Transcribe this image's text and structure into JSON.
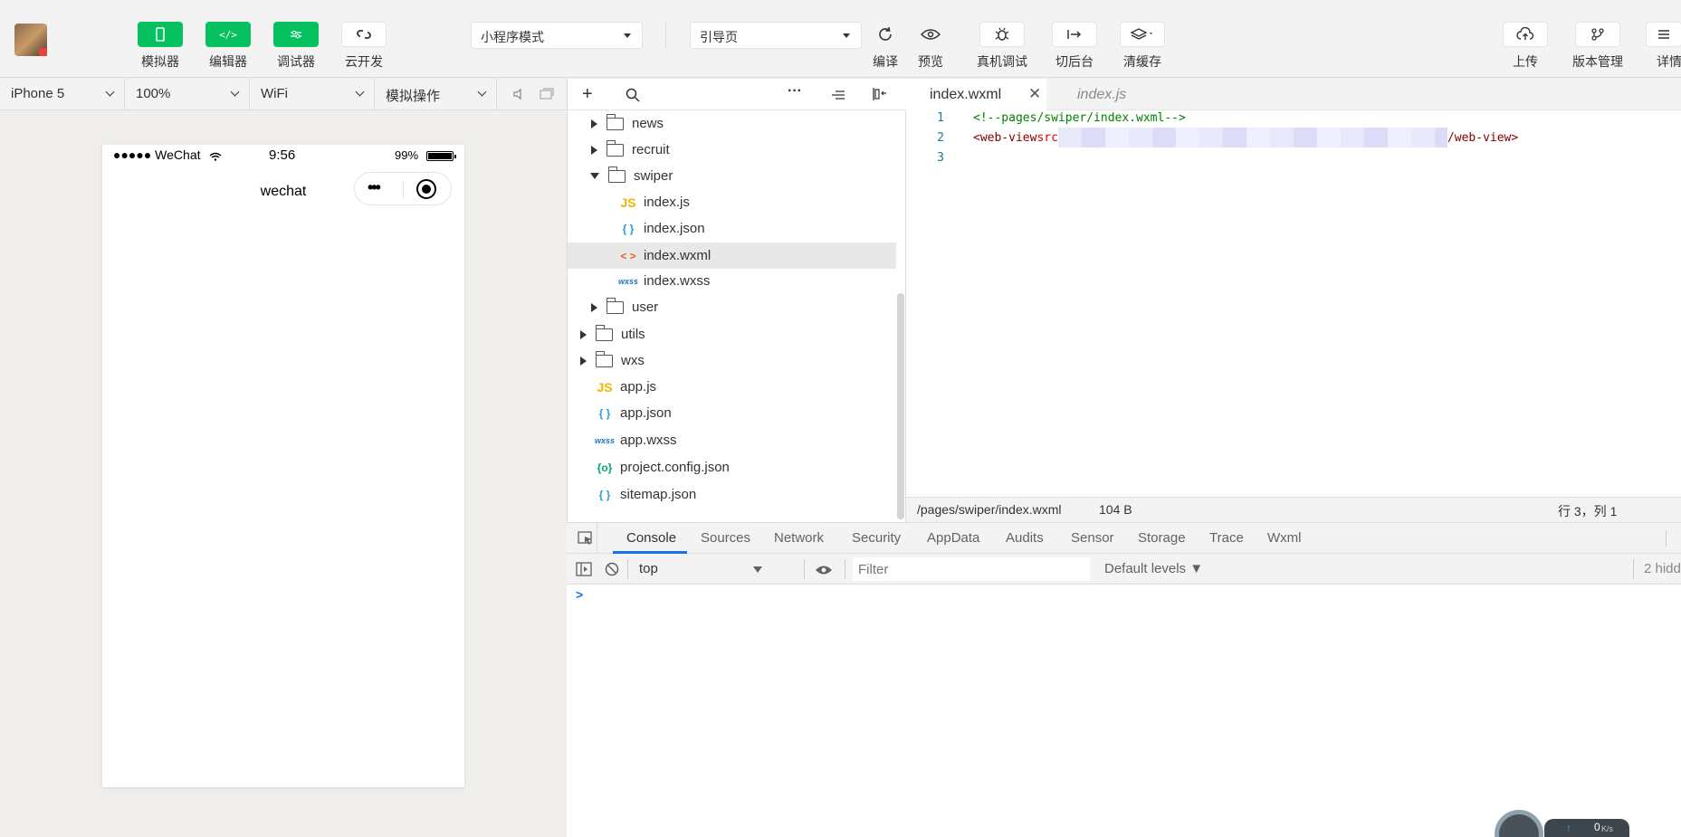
{
  "toolbar": {
    "buttons": [
      {
        "label": "模拟器",
        "icon": "phone-icon"
      },
      {
        "label": "编辑器",
        "icon": "code-icon"
      },
      {
        "label": "调试器",
        "icon": "debug-toggle-icon"
      },
      {
        "label": "云开发",
        "icon": "cloud-link-icon"
      }
    ],
    "mode_select": "小程序模式",
    "page_select": "引导页",
    "actions": [
      {
        "label": "编译",
        "icon": "refresh-icon"
      },
      {
        "label": "预览",
        "icon": "eye-icon"
      },
      {
        "label": "真机调试",
        "icon": "bug-icon"
      },
      {
        "label": "切后台",
        "icon": "switch-icon"
      },
      {
        "label": "清缓存",
        "icon": "layers-icon"
      }
    ],
    "right_actions": [
      {
        "label": "上传",
        "icon": "cloud-upload-icon"
      },
      {
        "label": "版本管理",
        "icon": "branch-icon"
      },
      {
        "label": "详情",
        "icon": "menu-icon"
      }
    ]
  },
  "simulator": {
    "device": "iPhone 5",
    "zoom": "100%",
    "network": "WiFi",
    "operation": "模拟操作",
    "phone": {
      "carrier": "●●●●● WeChat",
      "time": "9:56",
      "battery": "99%",
      "nav_title": "wechat",
      "capsule_more": "•••"
    }
  },
  "filetree": {
    "nodes": [
      {
        "label": "news",
        "type": "folder",
        "state": "collapsed"
      },
      {
        "label": "recruit",
        "type": "folder",
        "state": "collapsed"
      },
      {
        "label": "swiper",
        "type": "folder",
        "state": "expanded"
      },
      {
        "label": "index.js",
        "type": "js",
        "badge": "JS"
      },
      {
        "label": "index.json",
        "type": "json",
        "badge": "{ }"
      },
      {
        "label": "index.wxml",
        "type": "wxml",
        "badge": "< >",
        "selected": true
      },
      {
        "label": "index.wxss",
        "type": "wxss",
        "badge": "wxss"
      },
      {
        "label": "user",
        "type": "folder",
        "state": "collapsed"
      },
      {
        "label": "utils",
        "type": "folder",
        "state": "collapsed"
      },
      {
        "label": "wxs",
        "type": "folder",
        "state": "collapsed"
      },
      {
        "label": "app.js",
        "type": "js",
        "badge": "JS"
      },
      {
        "label": "app.json",
        "type": "json",
        "badge": "{ }"
      },
      {
        "label": "app.wxss",
        "type": "wxss",
        "badge": "wxss"
      },
      {
        "label": "project.config.json",
        "type": "cfg",
        "badge": "{o}"
      },
      {
        "label": "sitemap.json",
        "type": "json",
        "badge": "{ }"
      }
    ]
  },
  "editor": {
    "tabs": [
      {
        "label": "index.wxml",
        "active": true
      },
      {
        "label": "index.js",
        "active": false
      }
    ],
    "lines": [
      {
        "num": "1",
        "segments": [
          {
            "text": "<!--pages/swiper/index.wxml-->",
            "color": "#008000"
          }
        ]
      },
      {
        "num": "2",
        "segments": [
          {
            "text": "<",
            "color": "#800000"
          },
          {
            "text": "web-view",
            "color": "#800000"
          },
          {
            "text": " src",
            "color": "#e50000"
          },
          {
            "text": "",
            "color": "#333333",
            "redacted": true
          },
          {
            "text": "/web-view",
            "color": "#800000"
          },
          {
            "text": ">",
            "color": "#800000"
          }
        ]
      },
      {
        "num": "3",
        "segments": []
      }
    ],
    "status": {
      "path": "/pages/swiper/index.wxml",
      "size": "104 B",
      "cursor": "行 3，列 1"
    }
  },
  "devtools": {
    "tabs": [
      "Console",
      "Sources",
      "Network",
      "Security",
      "AppData",
      "Audits",
      "Sensor",
      "Storage",
      "Trace",
      "Wxml"
    ],
    "active_tab": "Console",
    "context": "top",
    "filter_placeholder": "Filter",
    "levels": "Default levels ▼",
    "hidden": "2 hidd",
    "prompt": ">"
  },
  "netwidget": {
    "value": "0",
    "unit": "K/s"
  },
  "colors": {
    "accent_green": "#07c160",
    "console_active_underline": "#1a73e8",
    "prompt_blue": "#1a73e8"
  }
}
